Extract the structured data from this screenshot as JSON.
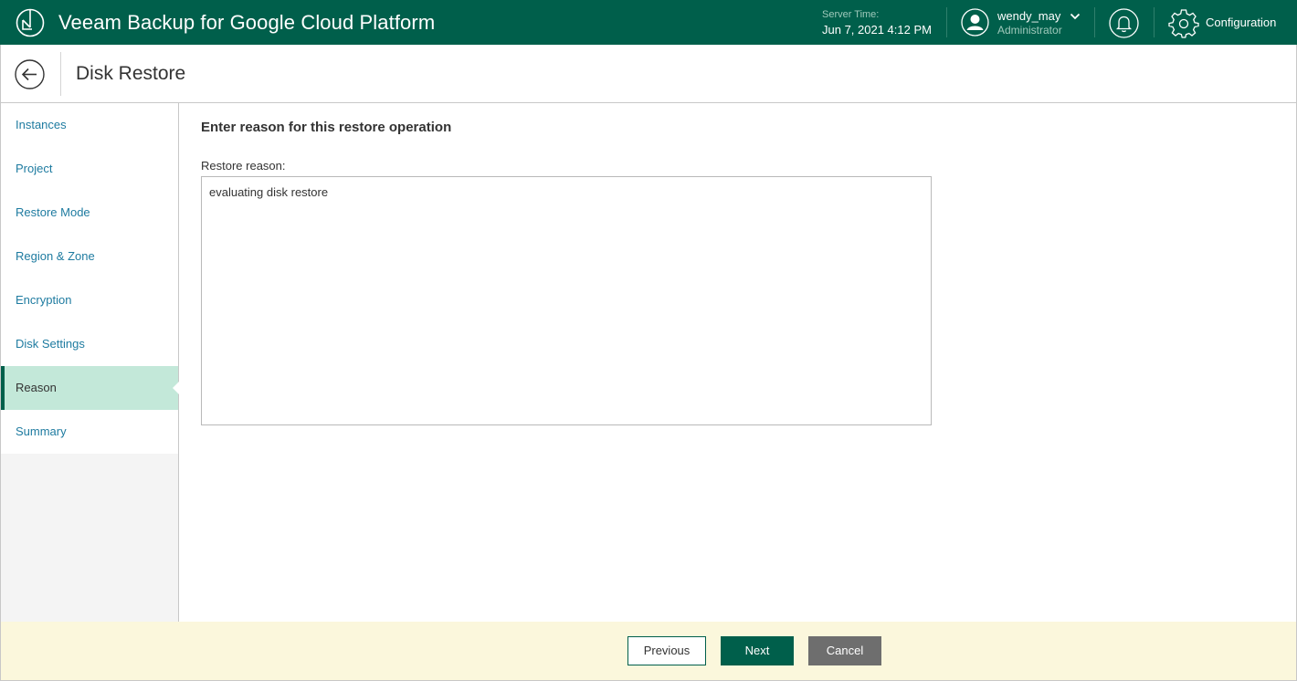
{
  "app": {
    "title": "Veeam Backup for Google Cloud Platform",
    "logo_icon": "veeam-logo-icon"
  },
  "topbar": {
    "server_time_label": "Server Time:",
    "server_time_value": "Jun 7, 2021 4:12 PM",
    "user_name": "wendy_may",
    "user_role": "Administrator",
    "configuration_label": "Configuration",
    "icons": [
      "user-avatar-icon",
      "chevron-down-icon",
      "bell-icon",
      "gear-icon"
    ]
  },
  "page": {
    "title": "Disk Restore",
    "back_icon": "back-arrow-icon"
  },
  "wizard": {
    "steps": [
      {
        "label": "Instances",
        "active": false
      },
      {
        "label": "Project",
        "active": false
      },
      {
        "label": "Restore Mode",
        "active": false
      },
      {
        "label": "Region & Zone",
        "active": false
      },
      {
        "label": "Encryption",
        "active": false
      },
      {
        "label": "Disk Settings",
        "active": false
      },
      {
        "label": "Reason",
        "active": true
      },
      {
        "label": "Summary",
        "active": false
      }
    ]
  },
  "main": {
    "section_title": "Enter reason for this restore operation",
    "field_label": "Restore reason:",
    "reason_value": "evaluating disk restore"
  },
  "footer": {
    "previous_label": "Previous",
    "next_label": "Next",
    "cancel_label": "Cancel"
  },
  "colors": {
    "brand_green": "#005f4b",
    "active_step_bg": "#c3e8d9",
    "link_blue": "#1e7ba0",
    "footer_bg": "#fbf7dc",
    "cancel_gray": "#6e6e6e"
  }
}
